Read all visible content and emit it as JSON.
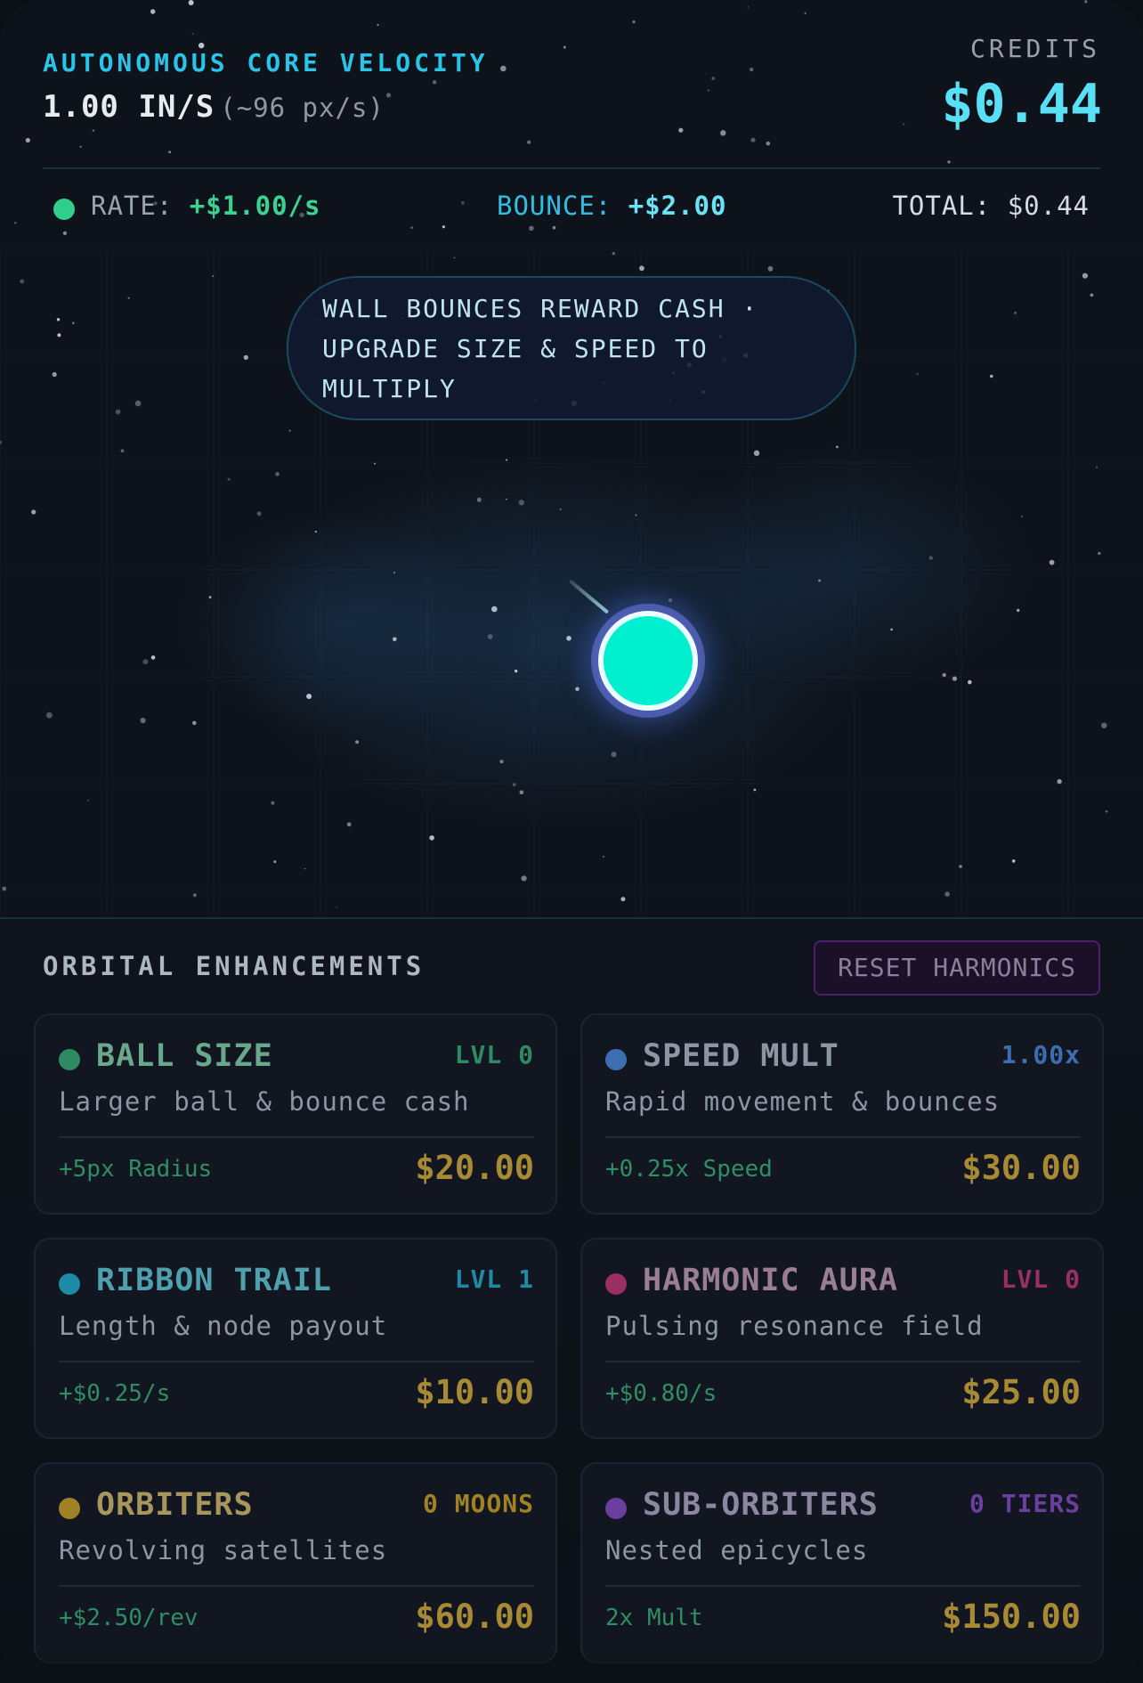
{
  "header": {
    "title": "AUTONOMOUS CORE VELOCITY",
    "speed": "1.00 IN/S",
    "speed_sub": "(~96 px/s)",
    "credits_label": "CREDITS",
    "credits": "$0.44"
  },
  "stats": {
    "rate_label": "RATE:",
    "rate_value": "+$1.00/s",
    "bounce_label": "BOUNCE:",
    "bounce_value": "+$2.00",
    "total_label": "TOTAL:",
    "total_value": "$0.44"
  },
  "hint": "WALL BOUNCES REWARD CASH · UPGRADE SIZE & SPEED TO MULTIPLY",
  "upgrades_panel": {
    "title": "ORBITAL ENHANCEMENTS",
    "reset_label": "RESET HARMONICS"
  },
  "upgrades": [
    {
      "name": "BALL SIZE",
      "level": "LVL 0",
      "desc": "Larger ball & bounce cash",
      "effect": "+5px Radius",
      "cost": "$20.00",
      "color": "#2e8a63",
      "name_color": "#6aa88c",
      "level_color": "#2e8a63"
    },
    {
      "name": "SPEED MULT",
      "level": "1.00x",
      "desc": "Rapid movement & bounces",
      "effect": "+0.25x Speed",
      "cost": "$30.00",
      "color": "#3d6fb0",
      "name_color": "#8d96a3",
      "level_color": "#3d6fb0"
    },
    {
      "name": "RIBBON TRAIL",
      "level": "LVL 1",
      "desc": "Length & node payout",
      "effect": "+$0.25/s",
      "cost": "$10.00",
      "color": "#1e8aa6",
      "name_color": "#4f9fae",
      "level_color": "#1e8aa6"
    },
    {
      "name": "HARMONIC AURA",
      "level": "LVL 0",
      "desc": "Pulsing resonance field",
      "effect": "+$0.80/s",
      "cost": "$25.00",
      "color": "#9a2f63",
      "name_color": "#9a7e92",
      "level_color": "#9a2f63"
    },
    {
      "name": "ORBITERS",
      "level": "0 MOONS",
      "desc": "Revolving satellites",
      "effect": "+$2.50/rev",
      "cost": "$60.00",
      "color": "#a08224",
      "name_color": "#a8965c",
      "level_color": "#a08224"
    },
    {
      "name": "SUB-ORBITERS",
      "level": "0 TIERS",
      "desc": "Nested epicycles",
      "effect": "2x Mult",
      "cost": "$150.00",
      "color": "#6a3fa0",
      "name_color": "#8d86a0",
      "level_color": "#6a3fa0"
    }
  ]
}
